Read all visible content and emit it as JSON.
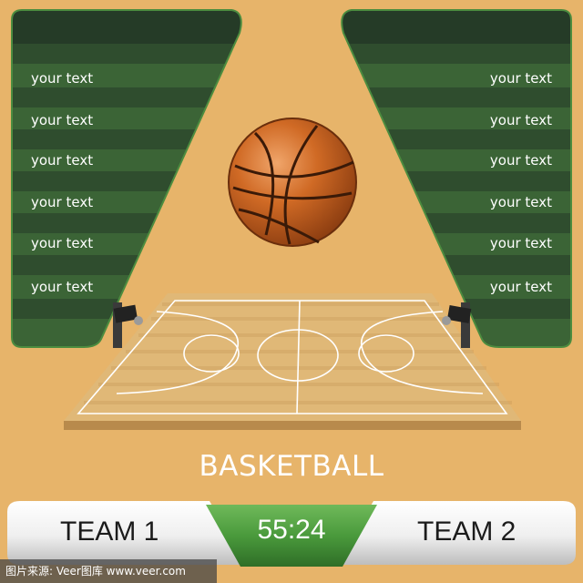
{
  "left_board": {
    "rows": [
      "your text",
      "your text",
      "your text",
      "your text",
      "your text",
      "your text"
    ]
  },
  "right_board": {
    "rows": [
      "your text",
      "your text",
      "your text",
      "your text",
      "your text",
      "your text"
    ]
  },
  "title": "BASKETBALL",
  "scoreboard": {
    "team1": "TEAM 1",
    "clock": "55:24",
    "team2": "TEAM 2"
  },
  "watermark": "图片来源: Veer图库 www.veer.com",
  "colors": {
    "background": "#e7b46a",
    "board_dark": "#2b4a2a",
    "board_light": "#3d6a3a",
    "board_border": "#4a8a3e",
    "clock_green": "#4c9a3e",
    "court_wood": "#e0b877",
    "ball_orange": "#c8621e"
  },
  "icons": [
    "basketball-icon",
    "hoop-left-icon",
    "hoop-right-icon"
  ]
}
